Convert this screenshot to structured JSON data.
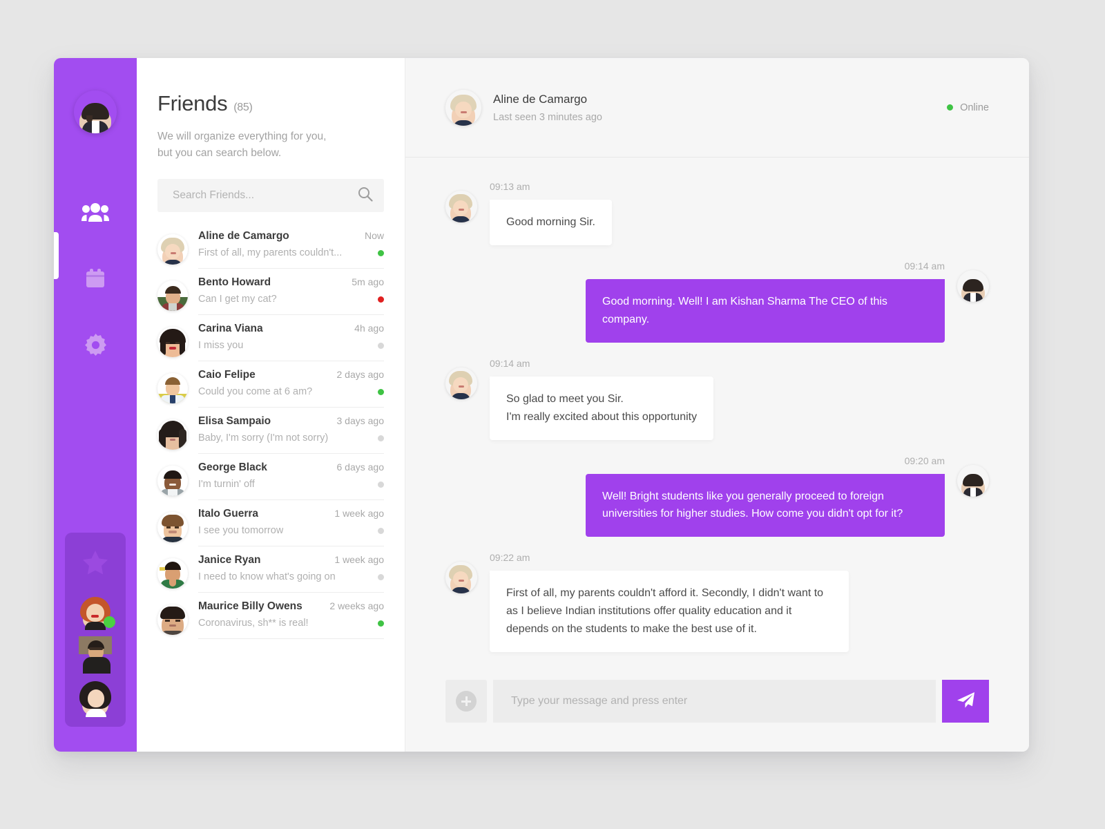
{
  "theme": {
    "brand_purple": "#a041ec",
    "rail_purple": "#a24df0",
    "rail_panel_purple": "#8c3fd6",
    "online_green": "#3fc344",
    "busy_red": "#e02020",
    "offline_gray": "#d8d8d8",
    "page_background": "#e6e6e6",
    "chat_background": "#f6f6f6"
  },
  "rail": {
    "user_avatar_name": "current-user-avatar",
    "nav": [
      {
        "icon": "friends-icon",
        "label": "Friends",
        "active": true
      },
      {
        "icon": "calendar-icon",
        "label": "Calendar",
        "active": false
      },
      {
        "icon": "settings-gear-icon",
        "label": "Settings",
        "active": false
      }
    ],
    "favorites": {
      "icon": "star-icon",
      "label": "Favorites",
      "contacts": [
        {
          "name": "favorite-contact-1",
          "status": "online"
        },
        {
          "name": "favorite-contact-2",
          "status": "offline"
        },
        {
          "name": "favorite-contact-3",
          "status": "offline"
        }
      ]
    }
  },
  "list_panel": {
    "title": "Friends",
    "count": "(85)",
    "subtitle": "We will organize everything for you,\nbut you can search below.",
    "search_placeholder": "Search Friends...",
    "search_value": "",
    "search_icon": "search-icon",
    "friends": [
      {
        "name": "Aline de Camargo",
        "time": "Now",
        "message": "First of all, my parents couldn't...",
        "status": "online"
      },
      {
        "name": "Bento Howard",
        "time": "5m ago",
        "message": "Can I get my cat?",
        "status": "busy"
      },
      {
        "name": "Carina Viana",
        "time": "4h ago",
        "message": "I miss you",
        "status": "offline"
      },
      {
        "name": "Caio Felipe",
        "time": "2 days ago",
        "message": "Could you come at 6 am?",
        "status": "online"
      },
      {
        "name": "Elisa Sampaio",
        "time": "3 days ago",
        "message": "Baby, I'm sorry (I'm not sorry)",
        "status": "offline"
      },
      {
        "name": "George Black",
        "time": "6 days ago",
        "message": "I'm turnin' off",
        "status": "offline"
      },
      {
        "name": "Italo Guerra",
        "time": "1 week ago",
        "message": "I see you tomorrow",
        "status": "offline"
      },
      {
        "name": "Janice Ryan",
        "time": "1 week ago",
        "message": "I need to know what's going on",
        "status": "offline"
      },
      {
        "name": "Maurice Billy Owens",
        "time": "2 weeks ago",
        "message": "Coronavirus, sh** is real!",
        "status": "online"
      }
    ]
  },
  "chat": {
    "header": {
      "name": "Aline de Camargo",
      "last_seen": "Last seen 3 minutes ago",
      "presence_label": "Online"
    },
    "messages": [
      {
        "side": "them",
        "time": "09:13 am",
        "text": "Good morning Sir."
      },
      {
        "side": "me",
        "time": "09:14 am",
        "text": "Good morning. Well! I am Kishan Sharma The CEO of this company."
      },
      {
        "side": "them",
        "time": "09:14 am",
        "text": "So glad to meet you Sir.\nI'm really excited about this opportunity"
      },
      {
        "side": "me",
        "time": "09:20 am",
        "text": "Well! Bright students like you generally proceed to foreign universities for higher studies. How come you didn't opt for it?"
      },
      {
        "side": "them",
        "time": "09:22 am",
        "text": "First of all, my parents couldn't afford it. Secondly, I didn't want to as I believe Indian institutions offer quality education and it depends on the students to make the best use of it."
      }
    ],
    "composer": {
      "attach_icon": "plus-icon",
      "placeholder": "Type your message and press enter",
      "value": "",
      "send_icon": "send-paper-plane-icon"
    }
  }
}
